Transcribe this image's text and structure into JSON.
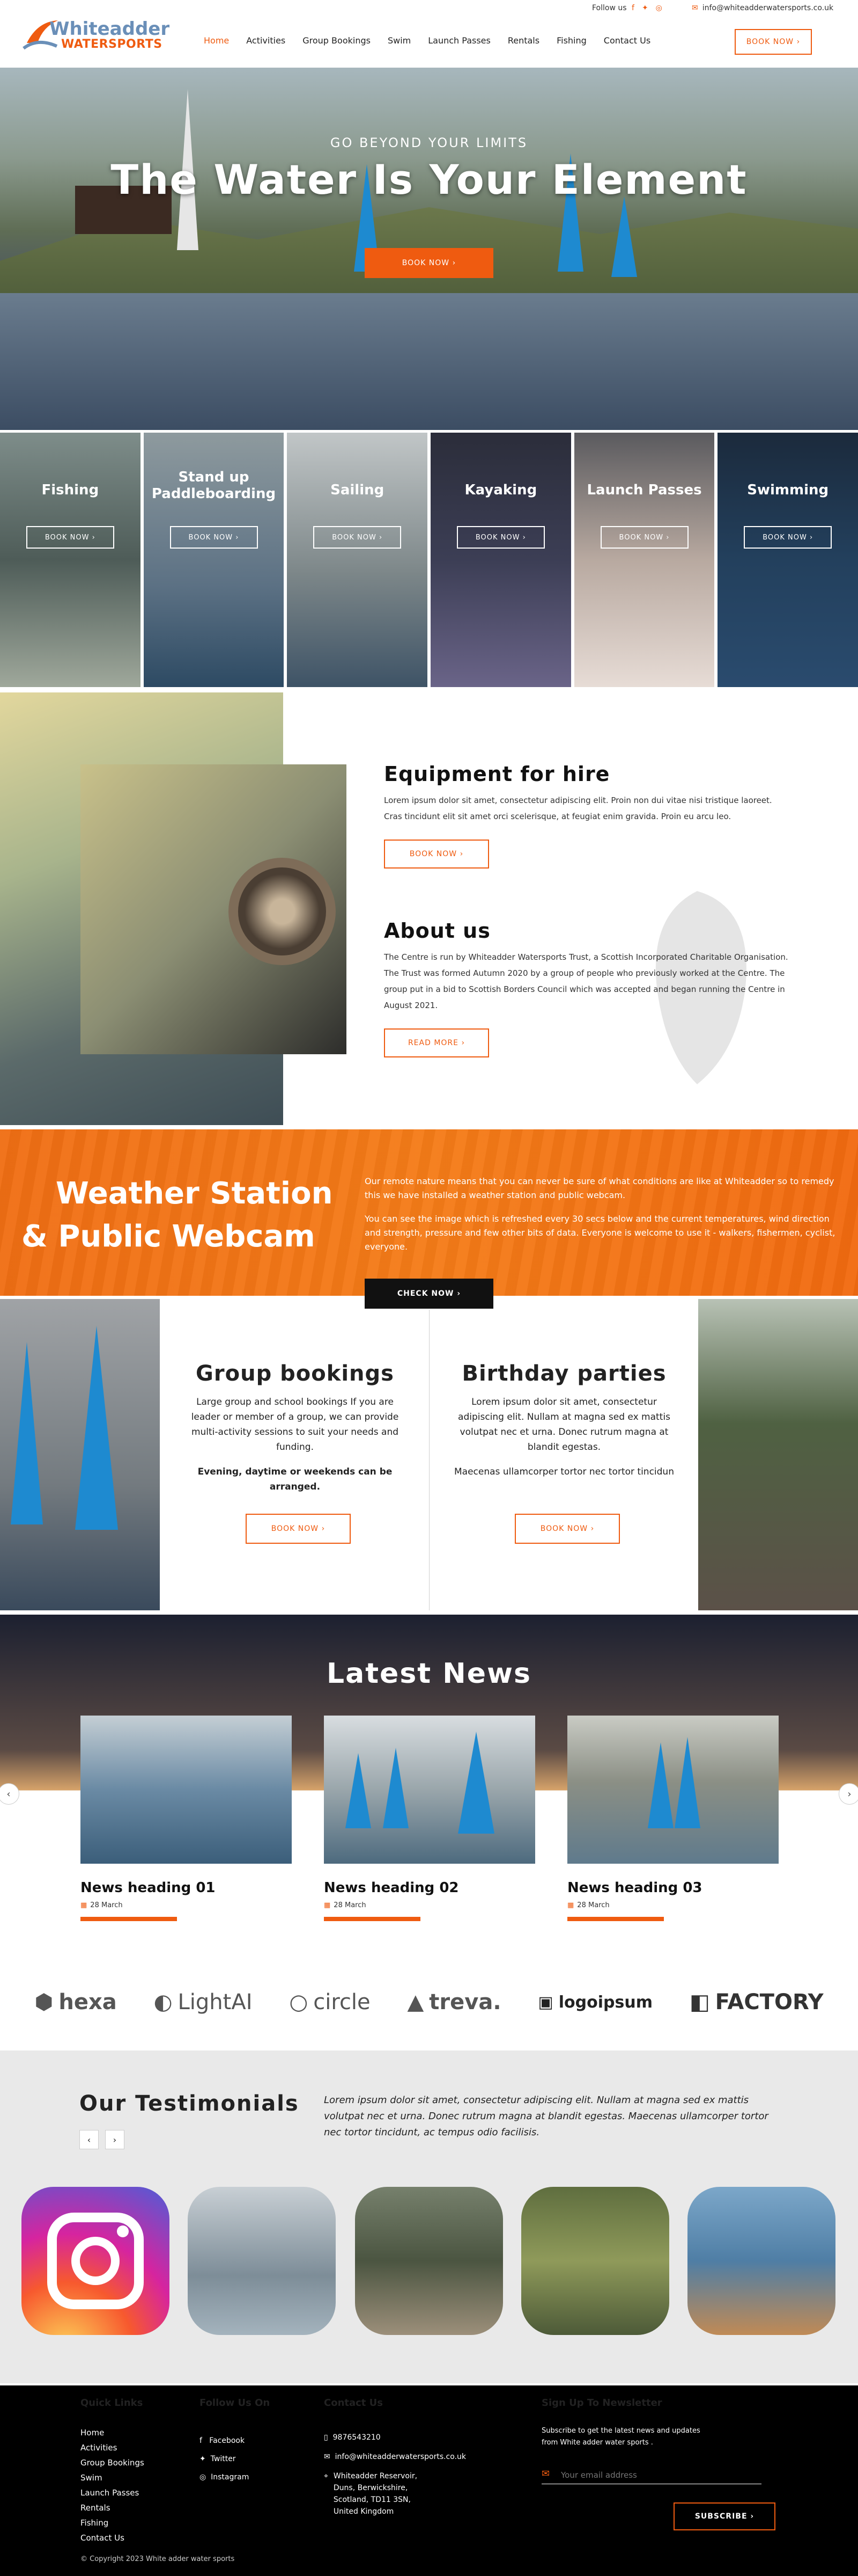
{
  "topbar": {
    "follow_label": "Follow us",
    "email": "info@whiteadderwatersports.co.uk"
  },
  "header": {
    "logo_line1": "Whiteadder",
    "logo_line2": "WATERSPORTS",
    "nav": [
      "Home",
      "Activities",
      "Group Bookings",
      "Swim",
      "Launch Passes",
      "Rentals",
      "Fishing",
      "Contact Us"
    ],
    "book_label": "BOOK NOW ›"
  },
  "hero": {
    "subtitle": "GO BEYOND YOUR LIMITS",
    "title": "The Water Is Your Element",
    "cta": "BOOK NOW ›"
  },
  "activities": [
    {
      "name": "Fishing",
      "cta": "BOOK NOW ›"
    },
    {
      "name": "Stand up Paddleboarding",
      "cta": "BOOK NOW ›"
    },
    {
      "name": "Sailing",
      "cta": "BOOK NOW ›"
    },
    {
      "name": "Kayaking",
      "cta": "BOOK NOW ›"
    },
    {
      "name": "Launch Passes",
      "cta": "BOOK NOW ›"
    },
    {
      "name": "Swimming",
      "cta": "BOOK NOW ›"
    }
  ],
  "equipment": {
    "title": "Equipment for hire",
    "text": "Lorem ipsum dolor sit amet, consectetur adipiscing elit. Proin non dui vitae nisi tristique laoreet. Cras tincidunt elit sit amet orci scelerisque, at feugiat enim gravida. Proin eu arcu leo.",
    "cta": "BOOK NOW ›"
  },
  "about": {
    "title": "About us",
    "text": "The Centre is run by Whiteadder Watersports Trust, a Scottish Incorporated Charitable Organisation. The Trust was formed Autumn 2020 by a group of people who previously worked at the Centre. The group put in a bid to Scottish Borders Council which was accepted and began running the Centre in August 2021.",
    "cta": "READ MORE ›"
  },
  "weather": {
    "title_line1": "Weather Station",
    "title_amp": "&",
    "title_line2": "Public Webcam",
    "text1": "Our remote nature means that you can never be sure of what conditions are like at Whiteadder so to remedy this we have installed a weather station and public webcam.",
    "text2": "You can see the image which is refreshed every 30 secs below and the current temperatures, wind direction and strength, pressure and few other bits of data. Everyone is welcome to use it - walkers, fishermen, cyclist, everyone.",
    "cta": "CHECK NOW ›"
  },
  "groups": {
    "title": "Group bookings",
    "text": "Large group and school bookings If you are leader or member of a group, we can provide multi-activity sessions to suit your needs and funding.",
    "bold": "Evening, daytime or weekends can be arranged.",
    "cta": "BOOK NOW ›"
  },
  "birthday": {
    "title": "Birthday parties",
    "text": "Lorem ipsum dolor sit amet, consectetur adipiscing elit. Nullam at magna sed ex mattis volutpat nec et urna. Donec rutrum magna at blandit egestas.",
    "text2": "Maecenas ullamcorper tortor nec tortor tincidun",
    "cta": "BOOK NOW ›"
  },
  "news": {
    "title": "Latest News",
    "items": [
      {
        "heading": "News heading 01",
        "date": "28 March"
      },
      {
        "heading": "News heading 02",
        "date": "28 March"
      },
      {
        "heading": "News heading 03",
        "date": "28 March"
      }
    ]
  },
  "logos": [
    "hexa",
    "LightAI",
    "circle",
    "treva.",
    "logoipsum",
    "FACTORY"
  ],
  "testimonials": {
    "title": "Our Testimonials",
    "quote": "Lorem ipsum dolor sit amet, consectetur adipiscing elit. Nullam at magna sed ex mattis volutpat nec et urna. Donec rutrum magna at blandit egestas. Maecenas ullamcorper tortor nec tortor tincidunt, ac tempus odio facilisis."
  },
  "footer": {
    "quick_title": "Quick Links",
    "quick": [
      "Home",
      "Activities",
      "Group Bookings",
      "Swim",
      "Launch Passes",
      "Rentals",
      "Fishing",
      "Contact Us"
    ],
    "follow_title": "Follow Us On",
    "follow": [
      "Facebook",
      "Twitter",
      "Instagram"
    ],
    "contact_title": "Contact Us",
    "phone": "9876543210",
    "email": "info@whiteadderwatersports.co.uk",
    "address": [
      "Whiteadder Reservoir,",
      "Duns, Berwickshire,",
      "Scotland, TD11 3SN,",
      "United Kingdom"
    ],
    "news_title": "Sign Up To Newsletter",
    "news_text": "Subscribe to get the latest news and updates from White adder water sports .",
    "email_placeholder": "Your email address",
    "subscribe": "SUBSCRIBE ›",
    "copyright": "© Copyright 2023 White adder water sports"
  },
  "colors": {
    "accent": "#ef5b10",
    "dark": "#000000"
  }
}
